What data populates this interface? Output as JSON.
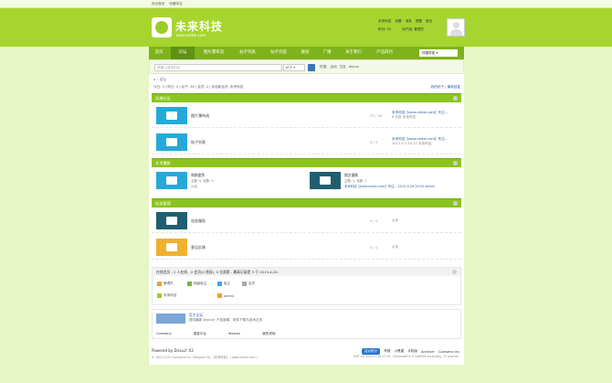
{
  "topbar": {
    "links": [
      "设为首页",
      "收藏本站"
    ]
  },
  "header": {
    "logo_title": "未来科技",
    "logo_sub": "www.veikei.com",
    "user": {
      "name": "未来科技",
      "links": [
        "设置",
        "消息",
        "提醒",
        "退出"
      ],
      "score_label": "积分: 32",
      "group_label": "用户组: 管理员"
    },
    "quick_nav": "快捷导航"
  },
  "nav": {
    "items": [
      "首页",
      "论坛",
      "图片瀑布流",
      "帖子列表",
      "帖子页面",
      "群组",
      "广播",
      "关于我们",
      "产品四列"
    ],
    "active": 1
  },
  "search": {
    "placeholder": "请输入搜索内容",
    "select": "帖子",
    "hot_label": "热搜:",
    "hot": [
      "活动",
      "交友",
      "discuz"
    ]
  },
  "breadcrumb": "论坛",
  "stats": {
    "text": "今日: 0 | 昨日: 0 | 帖子: 36 | 会员: 2 | 欢迎新会员: 未来科技",
    "right": "我的帖子 | 最新回复"
  },
  "categories": [
    {
      "title": "沟通社区",
      "forums": [
        {
          "name": "图片瀑布流",
          "count": "23 / 30",
          "last1": "未来科技【www.veikei.com】专注...",
          "last2": "6 天前 未来科技"
        },
        {
          "name": "帖子列表",
          "count": "5 / 5",
          "last1": "未来科技【www.veikei.com】专注...",
          "last2": "2013-5-3 14:27 未来科技"
        }
      ]
    },
    {
      "title": "艺术摄影",
      "forums": [
        {
          "name": "周期虚贸",
          "meta1": "主题: 0, 帖数: 0",
          "meta2": "从未"
        },
        {
          "name": "图文摄影",
          "meta1": "主题: 1, 帖数: 1",
          "meta2": "未来科技【www.veikei.com】专注... 2013-5-29 20:20 admin"
        }
      ]
    },
    {
      "title": "站务管理",
      "forums": [
        {
          "name": "站务服务",
          "count": "0 / 0",
          "last1": "从未"
        },
        {
          "name": "意见反馈",
          "count": "0 / 0",
          "last1": "从未"
        }
      ]
    }
  ],
  "online": {
    "header": "在线会员 - 2 人在线 - 2 会员(0 隐身), 0 位游客 - 最高记录是 3 于 2013-4-24.",
    "legend": [
      "管理员",
      "超级版主",
      "版主",
      "会员"
    ],
    "users": [
      "未来科技",
      "admin"
    ]
  },
  "links": {
    "title": "官方论坛",
    "desc": "提供最新 Discuz! 产品新闻、软件下载与技术交流",
    "partners": [
      "Comsenz",
      "漫游平台",
      "Yeswan",
      "我的领地"
    ]
  },
  "footer": {
    "powered": "Powered by Discuz! X3",
    "copyright": "© 2001-2013 Comsenz Inc. Template By 【未来科技】 ( www.veikei.com )",
    "badge": "站点统计",
    "right_links": [
      "举报",
      "小黑屋",
      "手机版",
      "Archiver",
      "Comsenz Inc."
    ],
    "gmt": "GMT+8, 2013-7-16 17:15 , Processed in 0.048959 second(s), 17 queries ."
  }
}
